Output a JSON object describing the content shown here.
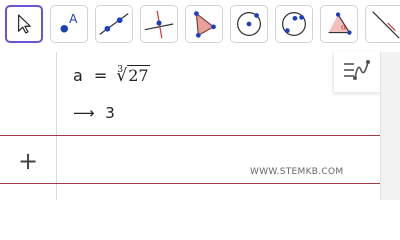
{
  "toolbar": {
    "tools": [
      {
        "name": "move-tool",
        "active": true
      },
      {
        "name": "point-tool",
        "active": false
      },
      {
        "name": "line-tool",
        "active": false
      },
      {
        "name": "perpendicular-line-tool",
        "active": false
      },
      {
        "name": "polygon-tool",
        "active": false
      },
      {
        "name": "circle-center-point-tool",
        "active": false
      },
      {
        "name": "circle-three-points-tool",
        "active": false
      },
      {
        "name": "angle-tool",
        "active": false
      },
      {
        "name": "reflect-tool",
        "active": false
      }
    ],
    "point_tool_label": "A",
    "angle_tool_label": "α"
  },
  "algebra": {
    "expression": {
      "variable": "a",
      "operator": "=",
      "root_index": "3",
      "radicand": "27"
    },
    "result": {
      "arrow": "⟶",
      "value": "3"
    },
    "add_input_label": "+"
  },
  "watermark": "WWW.STEMKB.COM",
  "colors": {
    "accent": "#6557d2",
    "separator": "#a33a4a",
    "point_blue": "#1b3fbf",
    "polygon_fill": "#e8a09a",
    "angle_red": "#d83a3a"
  }
}
